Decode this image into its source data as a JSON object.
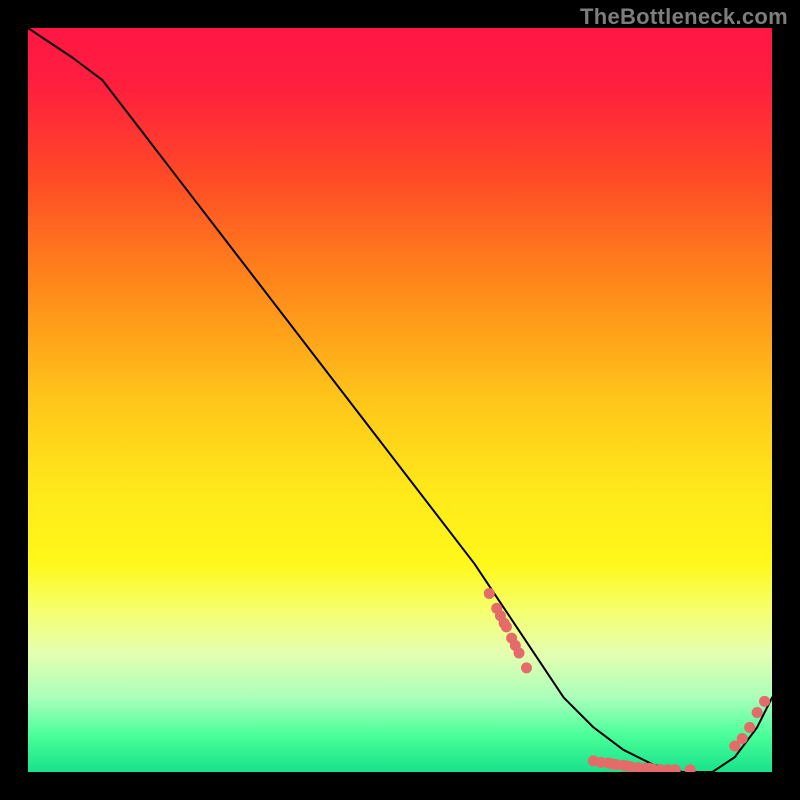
{
  "watermark": "TheBottleneck.com",
  "chart_data": {
    "type": "line",
    "title": "",
    "xlabel": "",
    "ylabel": "",
    "xlim": [
      0,
      100
    ],
    "ylim": [
      0,
      100
    ],
    "background_gradient": {
      "stops": [
        {
          "offset": 0.0,
          "color": "#ff1744"
        },
        {
          "offset": 0.08,
          "color": "#ff1f3e"
        },
        {
          "offset": 0.2,
          "color": "#ff4a26"
        },
        {
          "offset": 0.35,
          "color": "#ff8a1a"
        },
        {
          "offset": 0.5,
          "color": "#ffc61a"
        },
        {
          "offset": 0.62,
          "color": "#ffe81a"
        },
        {
          "offset": 0.72,
          "color": "#fff81a"
        },
        {
          "offset": 0.78,
          "color": "#f6ff6a"
        },
        {
          "offset": 0.84,
          "color": "#e5ffb0"
        },
        {
          "offset": 0.9,
          "color": "#aaffbb"
        },
        {
          "offset": 0.95,
          "color": "#4aff99"
        },
        {
          "offset": 1.0,
          "color": "#18e28a"
        }
      ]
    },
    "series": [
      {
        "name": "bottleneck-curve",
        "x": [
          0,
          6,
          10,
          20,
          30,
          40,
          50,
          60,
          64,
          68,
          72,
          76,
          80,
          84,
          88,
          92,
          95,
          98,
          100
        ],
        "y": [
          100,
          96,
          93,
          80,
          67,
          54,
          41,
          28,
          22,
          16,
          10,
          6,
          3,
          1,
          0,
          0,
          2,
          6,
          10
        ]
      }
    ],
    "scatter_points": {
      "name": "highlight-points",
      "color": "#e56a6a",
      "points": [
        {
          "x": 62,
          "y": 24
        },
        {
          "x": 63,
          "y": 22
        },
        {
          "x": 63.5,
          "y": 21
        },
        {
          "x": 64,
          "y": 20
        },
        {
          "x": 64.3,
          "y": 19.5
        },
        {
          "x": 65,
          "y": 18
        },
        {
          "x": 65.5,
          "y": 17
        },
        {
          "x": 66,
          "y": 16
        },
        {
          "x": 67,
          "y": 14
        },
        {
          "x": 76,
          "y": 1.5
        },
        {
          "x": 77,
          "y": 1.3
        },
        {
          "x": 78,
          "y": 1.2
        },
        {
          "x": 78.5,
          "y": 1.1
        },
        {
          "x": 79,
          "y": 1.0
        },
        {
          "x": 80,
          "y": 0.9
        },
        {
          "x": 80.5,
          "y": 0.8
        },
        {
          "x": 81,
          "y": 0.7
        },
        {
          "x": 82,
          "y": 0.6
        },
        {
          "x": 83,
          "y": 0.5
        },
        {
          "x": 83.5,
          "y": 0.5
        },
        {
          "x": 84,
          "y": 0.4
        },
        {
          "x": 85,
          "y": 0.3
        },
        {
          "x": 86,
          "y": 0.3
        },
        {
          "x": 87,
          "y": 0.3
        },
        {
          "x": 89,
          "y": 0.3
        },
        {
          "x": 95,
          "y": 3.5
        },
        {
          "x": 96,
          "y": 4.5
        },
        {
          "x": 97,
          "y": 6.0
        },
        {
          "x": 98,
          "y": 8.0
        },
        {
          "x": 99,
          "y": 9.5
        }
      ]
    }
  }
}
